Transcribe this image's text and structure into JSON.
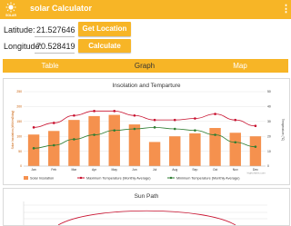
{
  "appbar": {
    "title": "solar Calculator",
    "logo_text": "SOLAR",
    "menu_icon": "more-vertical-icon"
  },
  "form": {
    "latitude_label": "Latitude:",
    "latitude_value": "21.527646",
    "longitude_label": "Longitude:",
    "longitude_value": "70.528419",
    "get_location_label": "Get Location",
    "calculate_label": "Calculate"
  },
  "tabs": [
    {
      "label": "Table",
      "active": false
    },
    {
      "label": "Graph",
      "active": true
    },
    {
      "label": "Map",
      "active": false
    }
  ],
  "colors": {
    "accent": "#f7b526",
    "bar": "#f5914e",
    "line_max": "#c8102e",
    "line_avg": "#2e7d32",
    "sun_path": "#c8102e"
  },
  "chart_data": [
    {
      "type": "bar",
      "title": "Insolation and Temparture",
      "ylabel_left": "Solar Insolation (kWh/m2/day)",
      "ylabel_right": "Temperature (°C)",
      "categories": [
        "Jan",
        "Feb",
        "Mar",
        "Apr",
        "May",
        "Jun",
        "Jul",
        "Aug",
        "Sep",
        "Oct",
        "Nov",
        "Dec"
      ],
      "y_left_ticks": [
        "0",
        "50",
        "100",
        "150",
        "200",
        "250"
      ],
      "y_right_ticks": [
        "0",
        "10",
        "20",
        "30",
        "40",
        "50"
      ],
      "y_left_range": [
        0,
        250
      ],
      "y_right_range": [
        0,
        50
      ],
      "series": [
        {
          "name": "Solar Insolation",
          "kind": "bar",
          "axis": "left",
          "values": [
            106,
            118,
            155,
            168,
            172,
            140,
            81,
            100,
            110,
            128,
            112,
            100
          ]
        },
        {
          "name": "Maximum Temperature (Monthly Average)",
          "kind": "line",
          "axis": "right",
          "values": [
            26,
            29,
            34,
            37,
            37,
            34,
            31,
            31,
            32,
            35,
            31,
            27
          ]
        },
        {
          "name": "Minimum Temperature (Monthly Average)",
          "kind": "line",
          "axis": "right",
          "values": [
            12,
            14,
            18,
            21,
            24,
            25,
            26,
            25,
            24,
            21,
            16,
            13
          ]
        }
      ],
      "credit": "highcharts.com"
    },
    {
      "type": "line",
      "title": "Sun Path"
    }
  ]
}
